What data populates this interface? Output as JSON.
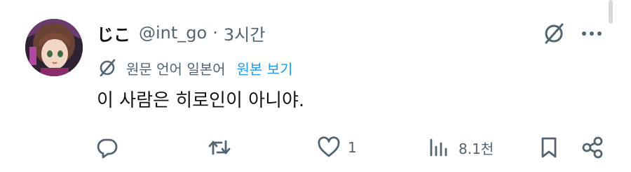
{
  "user": {
    "display_name": "じこ",
    "handle": "@int_go",
    "separator": "·",
    "time_ago": "3시간"
  },
  "translation": {
    "original_language": "원문 언어 일본어",
    "view_original": "원본 보기"
  },
  "post": {
    "text": "이 사람은 히로인이 아니야."
  },
  "actions": {
    "likes_count": "1",
    "views_count": "8.1천"
  },
  "icons": {
    "translate": "translate-icon",
    "more": "more-icon",
    "reply": "reply-icon",
    "retweet": "retweet-icon",
    "like": "heart-icon",
    "views": "views-icon",
    "bookmark": "bookmark-icon",
    "share": "share-icon"
  },
  "colors": {
    "text_primary": "#0f1419",
    "text_secondary": "#536471",
    "link": "#1d9bf0"
  }
}
